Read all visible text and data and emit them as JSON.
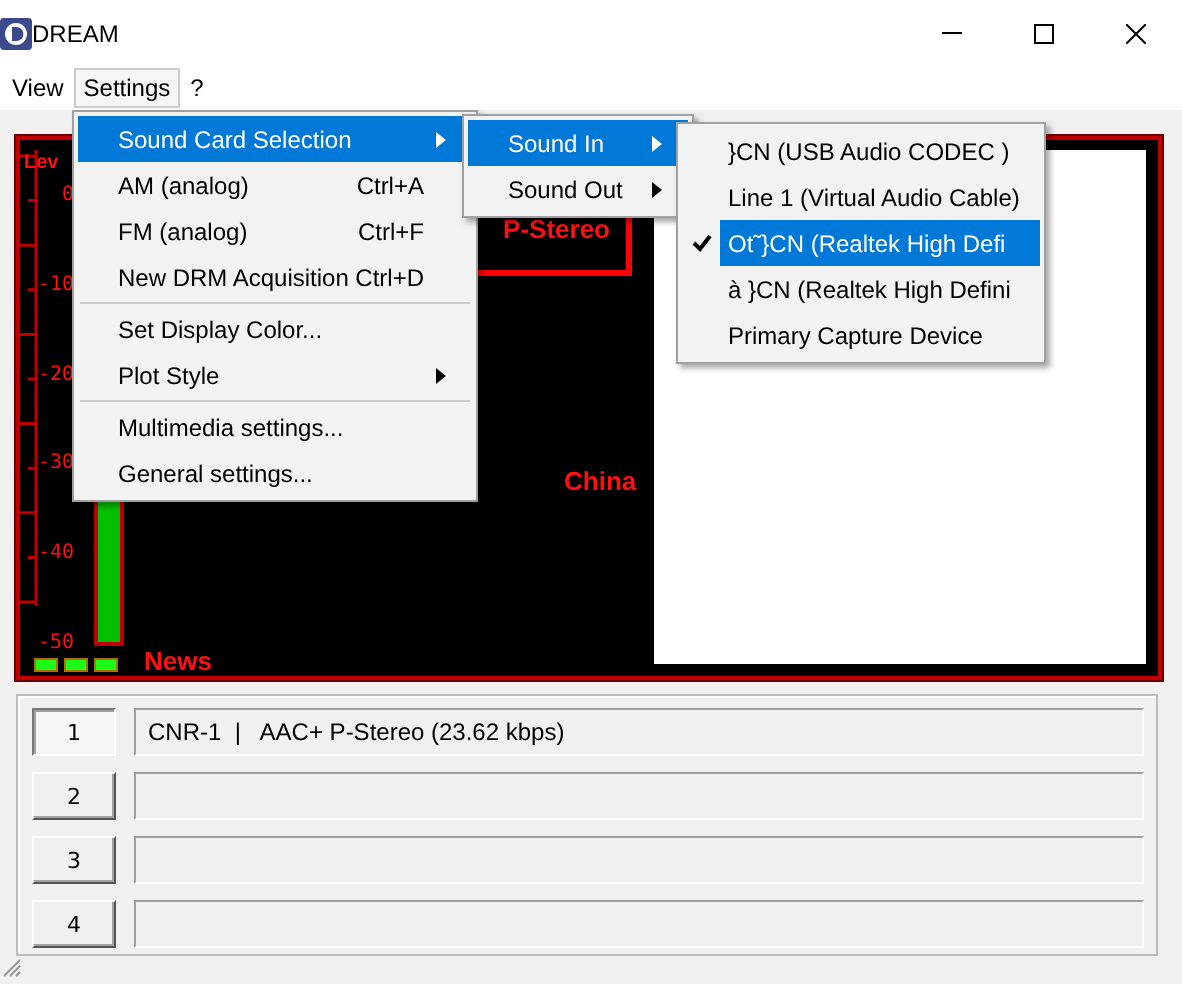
{
  "window": {
    "title": "DREAM"
  },
  "menubar": [
    {
      "label": "View",
      "selected": false
    },
    {
      "label": "Settings",
      "selected": true
    },
    {
      "label": "?",
      "selected": false
    }
  ],
  "settings_menu": [
    {
      "kind": "item",
      "label": "Sound Card Selection",
      "submenu": true,
      "selected": true
    },
    {
      "kind": "item",
      "label": "AM (analog)",
      "shortcut": "Ctrl+A",
      "selected": false
    },
    {
      "kind": "item",
      "label": "FM (analog)",
      "shortcut": "Ctrl+F",
      "selected": false
    },
    {
      "kind": "item",
      "label": "New DRM Acquisition",
      "shortcut": "Ctrl+D",
      "selected": false
    },
    {
      "kind": "separator"
    },
    {
      "kind": "item",
      "label": "Set Display Color...",
      "selected": false
    },
    {
      "kind": "item",
      "label": "Plot Style",
      "submenu": true,
      "selected": false
    },
    {
      "kind": "separator"
    },
    {
      "kind": "item",
      "label": "Multimedia settings...",
      "selected": false
    },
    {
      "kind": "item",
      "label": "General settings...",
      "selected": false
    }
  ],
  "sound_menu": [
    {
      "label": "Sound In",
      "submenu": true,
      "selected": true
    },
    {
      "label": "Sound Out",
      "submenu": true,
      "selected": false
    }
  ],
  "device_menu": [
    {
      "label": "}CN (USB Audio CODEC )",
      "checked": false,
      "selected": false
    },
    {
      "label": "Line 1 (Virtual Audio Cable)",
      "checked": false,
      "selected": false
    },
    {
      "label": "Ot˜}CN (Realtek High Defi",
      "checked": true,
      "selected": true
    },
    {
      "label": "à }CN (Realtek High Defini",
      "checked": false,
      "selected": false
    },
    {
      "label": "Primary Capture Device",
      "checked": false,
      "selected": false
    }
  ],
  "display": {
    "level_caption": "Lev",
    "scale": [
      "0",
      "-10",
      "-20",
      "-30",
      "-40",
      "-50"
    ],
    "level": 0.95,
    "indicators": [
      {
        "on": true
      },
      {
        "on": true
      },
      {
        "on": true
      }
    ],
    "audio_mode": "P-Stereo",
    "country": "China",
    "program_type": "News"
  },
  "services": [
    {
      "number": "1",
      "selected": true,
      "label": "CNR-1  |   AAC+ P-Stereo (23.62 kbps)"
    },
    {
      "number": "2",
      "selected": false
    },
    {
      "number": "3",
      "selected": false
    },
    {
      "number": "4",
      "selected": false
    }
  ]
}
